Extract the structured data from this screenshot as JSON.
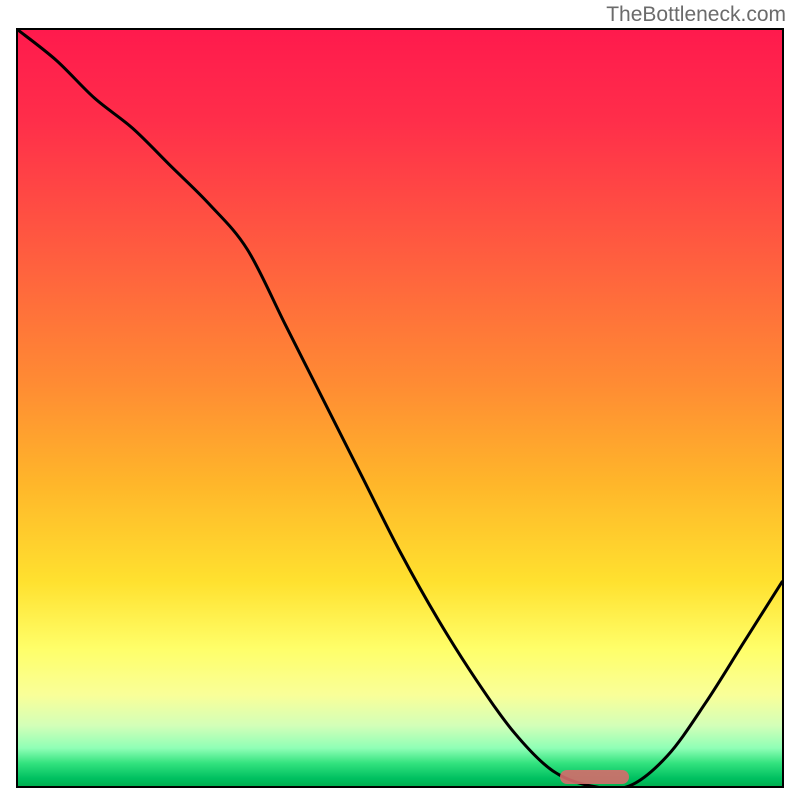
{
  "watermark": "TheBottleneck.com",
  "chart_data": {
    "type": "line",
    "title": "",
    "xlabel": "",
    "ylabel": "",
    "x": [
      0.0,
      0.05,
      0.1,
      0.15,
      0.2,
      0.25,
      0.3,
      0.35,
      0.4,
      0.45,
      0.5,
      0.55,
      0.6,
      0.65,
      0.7,
      0.75,
      0.8,
      0.85,
      0.9,
      0.95,
      1.0
    ],
    "y": [
      1.0,
      0.96,
      0.91,
      0.87,
      0.82,
      0.77,
      0.71,
      0.61,
      0.51,
      0.41,
      0.31,
      0.22,
      0.14,
      0.07,
      0.02,
      0.0,
      0.0,
      0.04,
      0.11,
      0.19,
      0.27
    ],
    "xlim": [
      0,
      1
    ],
    "ylim": [
      0,
      1
    ],
    "optimal_range_x": [
      0.71,
      0.8
    ],
    "background_gradient_stops": [
      {
        "pos": 0.0,
        "color": "#ff1a4d"
      },
      {
        "pos": 0.47,
        "color": "#ff8c33"
      },
      {
        "pos": 0.73,
        "color": "#ffe12f"
      },
      {
        "pos": 0.92,
        "color": "#d3ffb8"
      },
      {
        "pos": 1.0,
        "color": "#00b050"
      }
    ]
  }
}
